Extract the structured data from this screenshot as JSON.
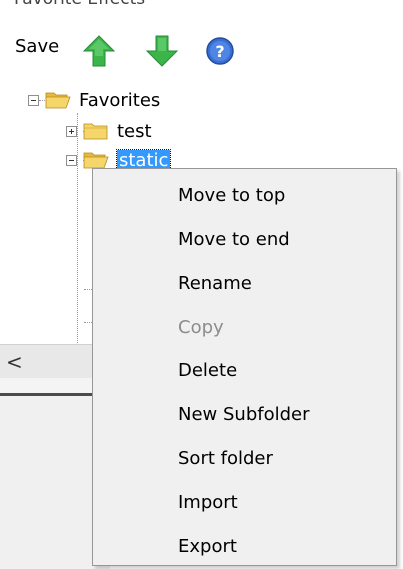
{
  "window": {
    "title": "Favorite Effects"
  },
  "toolbar": {
    "save_label": "Save",
    "up_icon": "green-up-arrow-icon",
    "down_icon": "green-down-arrow-icon",
    "help_icon": "help-icon"
  },
  "tree": {
    "nodes": [
      {
        "label": "Favorites",
        "expanded": true,
        "icon": "open-folder-icon"
      },
      {
        "label": "test",
        "expanded": false,
        "icon": "folder-icon"
      },
      {
        "label": "static",
        "expanded": true,
        "selected": true,
        "icon": "open-folder-icon"
      }
    ]
  },
  "scrollbar": {
    "left_arrow": "<"
  },
  "context_menu": {
    "items": [
      {
        "label": "Move to top",
        "enabled": true
      },
      {
        "label": "Move to end",
        "enabled": true
      },
      {
        "label": "Rename",
        "enabled": true
      },
      {
        "label": "Copy",
        "enabled": false
      },
      {
        "label": "Delete",
        "enabled": true
      },
      {
        "label": "New Subfolder",
        "enabled": true
      },
      {
        "label": "Sort folder",
        "enabled": true
      },
      {
        "label": "Import",
        "enabled": true
      },
      {
        "label": "Export",
        "enabled": true
      }
    ]
  },
  "colors": {
    "selection": "#3399ff",
    "menu_background": "#f0f0f0",
    "disabled_text": "#8c8c8c",
    "arrow_green": "#3bb54a",
    "folder_yellow": "#f5d66a"
  }
}
